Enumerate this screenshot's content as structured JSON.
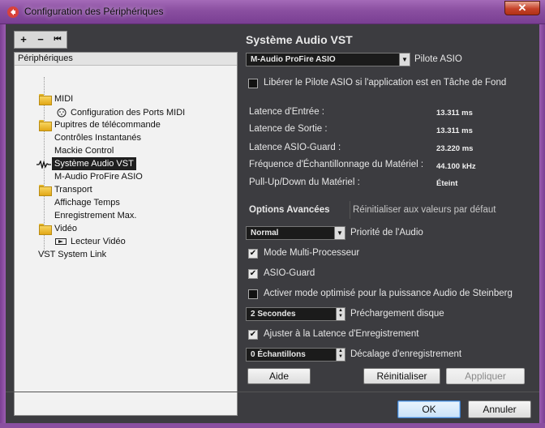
{
  "window": {
    "title": "Configuration des Périphériques",
    "close_label": "✕"
  },
  "toolbar": {
    "add": "+",
    "remove": "−",
    "reset": "⏮"
  },
  "tree": {
    "header": "Périphériques",
    "items": [
      {
        "label": "MIDI",
        "icon": "folder-icon"
      },
      {
        "label": "Configuration des Ports MIDI",
        "icon": "midi-port-icon"
      },
      {
        "label": "Pupitres de télécommande",
        "icon": "folder-icon"
      },
      {
        "label": "Contrôles Instantanés",
        "icon": ""
      },
      {
        "label": "Mackie Control",
        "icon": ""
      },
      {
        "label": "Système Audio VST",
        "icon": "audio-system-icon"
      },
      {
        "label": "M-Audio ProFire ASIO",
        "icon": ""
      },
      {
        "label": "Transport",
        "icon": "folder-icon"
      },
      {
        "label": "Affichage Temps",
        "icon": ""
      },
      {
        "label": "Enregistrement Max.",
        "icon": ""
      },
      {
        "label": "Vidéo",
        "icon": "folder-icon"
      },
      {
        "label": "Lecteur Vidéo",
        "icon": "video-player-icon"
      },
      {
        "label": "VST System Link",
        "icon": ""
      }
    ]
  },
  "main": {
    "title": "Système Audio VST",
    "driver_select": "M-Audio ProFire ASIO",
    "driver_label": "Pilote ASIO",
    "release_driver": {
      "label": "Libérer le Pilote ASIO si l'application est en Tâche de Fond",
      "checked": false
    },
    "stats": [
      {
        "label": "Latence d'Entrée :",
        "value": "13.311 ms"
      },
      {
        "label": "Latence de Sortie :",
        "value": "13.311 ms"
      },
      {
        "label": "Latence ASIO-Guard :",
        "value": "23.220 ms"
      },
      {
        "label": "Fréquence d'Échantillonnage du Matériel :",
        "value": "44.100 kHz"
      },
      {
        "label": "Pull-Up/Down du Matériel :",
        "value": "Éteint"
      }
    ],
    "tabs": {
      "advanced": "Options Avancées",
      "reset_defaults": "Réinitialiser aux valeurs par défaut"
    },
    "audio_priority": {
      "value": "Normal",
      "label": "Priorité de l'Audio"
    },
    "multi_processor": {
      "label": "Mode Multi-Processeur",
      "checked": true
    },
    "asio_guard": {
      "label": "ASIO-Guard",
      "checked": true
    },
    "steinberg_mode": {
      "label": "Activer mode optimisé pour la puissance Audio de Steinberg",
      "checked": false
    },
    "disk_preload": {
      "value": "2 Secondes",
      "label": "Préchargement disque"
    },
    "record_latency": {
      "label": "Ajuster à la Latence d'Enregistrement",
      "checked": true
    },
    "record_offset": {
      "value": "0 Échantillons",
      "label": "Décalage d'enregistrement"
    },
    "buttons": {
      "help": "Aide",
      "reset": "Réinitialiser",
      "apply": "Appliquer"
    }
  },
  "footer": {
    "ok": "OK",
    "cancel": "Annuler"
  }
}
